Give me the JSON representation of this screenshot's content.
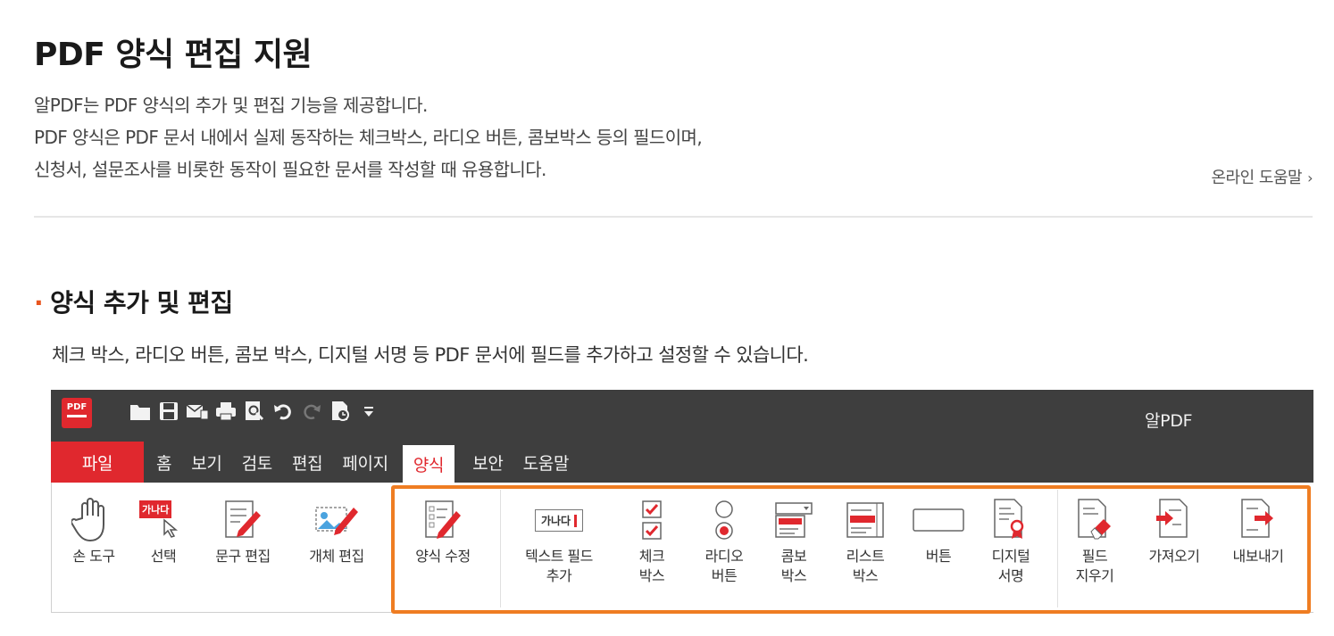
{
  "header": {
    "title": "PDF 양식 편집 지원",
    "intro_lines": [
      "알PDF는 PDF 양식의 추가 및 편집 기능을 제공합니다.",
      "PDF 양식은 PDF 문서 내에서 실제 동작하는 체크박스, 라디오 버튼, 콤보박스 등의 필드이며,",
      "신청서, 설문조사를 비롯한 동작이 필요한 문서를 작성할 때 유용합니다."
    ],
    "help_link": "온라인 도움말",
    "help_chevron": "›"
  },
  "section": {
    "bullet": "·",
    "heading": "양식 추가 및 편집",
    "description": "체크 박스, 라디오 버튼, 콤보 박스, 디지털 서명 등 PDF 문서에 필드를 추가하고 설정할 수 있습니다."
  },
  "app": {
    "logo_text": "PDF",
    "window_title": "알PDF",
    "quick_access_icons": [
      "open-folder-icon",
      "save-icon",
      "mail-icon",
      "print-icon",
      "find-icon",
      "undo-icon",
      "redo-icon",
      "properties-icon",
      "customize-dropdown-icon"
    ],
    "menu": [
      "파일",
      "홈",
      "보기",
      "검토",
      "편집",
      "페이지",
      "양식",
      "보안",
      "도움말"
    ],
    "active_menu": "양식",
    "ribbon": {
      "hand_tool": "손 도구",
      "select": "선택",
      "select_badge": "가나다",
      "text_edit": "문구 편집",
      "object_edit": "개체 편집",
      "form_edit": "양식 수정",
      "text_field": [
        "텍스트 필드",
        "추가"
      ],
      "text_field_badge": "가나다",
      "checkbox": [
        "체크",
        "박스"
      ],
      "radio": [
        "라디오",
        "버튼"
      ],
      "combo": [
        "콤보",
        "박스"
      ],
      "list": [
        "리스트",
        "박스"
      ],
      "button": "버튼",
      "digital_sign": [
        "디지털",
        "서명"
      ],
      "clear_fields": [
        "필드",
        "지우기"
      ],
      "import": "가져오기",
      "export": "내보내기"
    }
  },
  "colors": {
    "accent_red": "#e0282e",
    "highlight_orange": "#ef7d22",
    "titlebar_dark": "#3e3e3e"
  }
}
